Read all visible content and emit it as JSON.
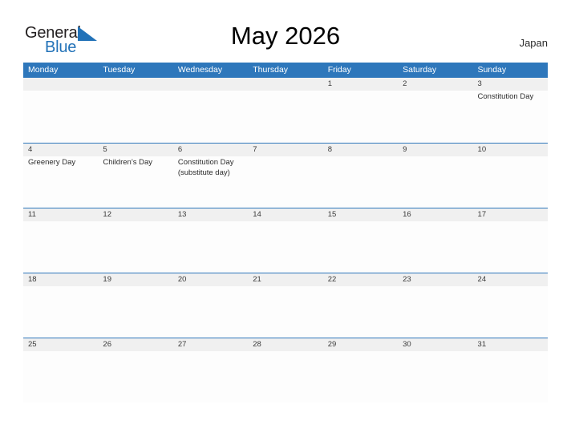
{
  "header": {
    "logo": {
      "word_one": "General",
      "word_two": "Blue",
      "triangle_icon": "triangle-icon",
      "brand_color": "#2272b8"
    },
    "title": "May 2026",
    "country": "Japan"
  },
  "calendar": {
    "header_color": "#2e77bb",
    "weekdays": [
      "Monday",
      "Tuesday",
      "Wednesday",
      "Thursday",
      "Friday",
      "Saturday",
      "Sunday"
    ],
    "weeks": [
      {
        "days": [
          {
            "number": "",
            "events": []
          },
          {
            "number": "",
            "events": []
          },
          {
            "number": "",
            "events": []
          },
          {
            "number": "",
            "events": []
          },
          {
            "number": "1",
            "events": []
          },
          {
            "number": "2",
            "events": []
          },
          {
            "number": "3",
            "events": [
              "Constitution Day"
            ]
          }
        ]
      },
      {
        "days": [
          {
            "number": "4",
            "events": [
              "Greenery Day"
            ]
          },
          {
            "number": "5",
            "events": [
              "Children’s Day"
            ]
          },
          {
            "number": "6",
            "events": [
              "Constitution Day",
              "(substitute day)"
            ]
          },
          {
            "number": "7",
            "events": []
          },
          {
            "number": "8",
            "events": []
          },
          {
            "number": "9",
            "events": []
          },
          {
            "number": "10",
            "events": []
          }
        ]
      },
      {
        "days": [
          {
            "number": "11",
            "events": []
          },
          {
            "number": "12",
            "events": []
          },
          {
            "number": "13",
            "events": []
          },
          {
            "number": "14",
            "events": []
          },
          {
            "number": "15",
            "events": []
          },
          {
            "number": "16",
            "events": []
          },
          {
            "number": "17",
            "events": []
          }
        ]
      },
      {
        "days": [
          {
            "number": "18",
            "events": []
          },
          {
            "number": "19",
            "events": []
          },
          {
            "number": "20",
            "events": []
          },
          {
            "number": "21",
            "events": []
          },
          {
            "number": "22",
            "events": []
          },
          {
            "number": "23",
            "events": []
          },
          {
            "number": "24",
            "events": []
          }
        ]
      },
      {
        "days": [
          {
            "number": "25",
            "events": []
          },
          {
            "number": "26",
            "events": []
          },
          {
            "number": "27",
            "events": []
          },
          {
            "number": "28",
            "events": []
          },
          {
            "number": "29",
            "events": []
          },
          {
            "number": "30",
            "events": []
          },
          {
            "number": "31",
            "events": []
          }
        ]
      }
    ]
  }
}
